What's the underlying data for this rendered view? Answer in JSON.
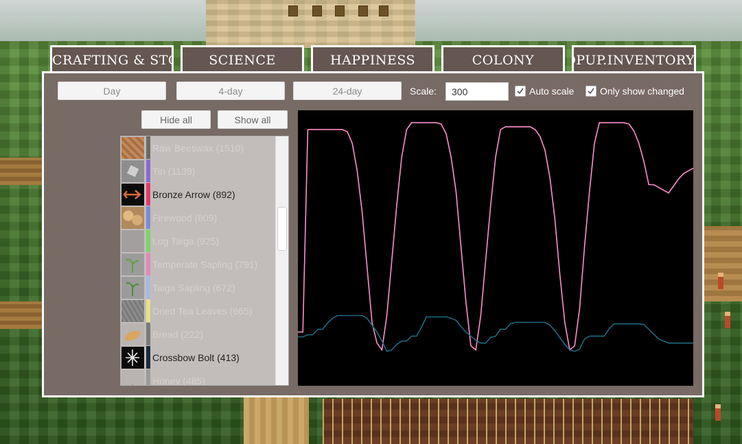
{
  "tabs": [
    {
      "label": "CRAFTING & STOCKPILE"
    },
    {
      "label": "SCIENCE"
    },
    {
      "label": "HAPPINESS"
    },
    {
      "label": "COLONY"
    },
    {
      "label": "POPUP.INVENTORY.STATS.HEADER"
    }
  ],
  "controls": {
    "day": "Day",
    "four_day": "4-day",
    "twentyfour_day": "24-day",
    "scale_label": "Scale:",
    "scale_value": "300",
    "auto_scale_label": "Auto scale",
    "auto_scale_checked": true,
    "only_changed_label": "Only show changed",
    "only_changed_checked": true,
    "hide_all": "Hide all",
    "show_all": "Show all"
  },
  "items": [
    {
      "label": "Raw Beeswax (1510)",
      "color": "#6b6b6b",
      "icon": "beeswax-icon",
      "enabled": false
    },
    {
      "label": "Tin (1139)",
      "color": "#8a6ad1",
      "icon": "tin-icon",
      "enabled": false
    },
    {
      "label": "Bronze Arrow (892)",
      "color": "#e43b6b",
      "icon": "bronze-arrow-icon",
      "enabled": true
    },
    {
      "label": "Firewood (809)",
      "color": "#7d8bd8",
      "icon": "firewood-icon",
      "enabled": false
    },
    {
      "label": "Log Taiga (925)",
      "color": "#7ed36b",
      "icon": "log-taiga-icon",
      "enabled": false
    },
    {
      "label": "Temperate Sapling (791)",
      "color": "#e08ab8",
      "icon": "temperate-sapling-icon",
      "enabled": false
    },
    {
      "label": "Taiga Sapling (672)",
      "color": "#a8b8e0",
      "icon": "taiga-sapling-icon",
      "enabled": false
    },
    {
      "label": "Dried Tea Leaves (665)",
      "color": "#e6e08a",
      "icon": "dried-tea-leaves-icon",
      "enabled": false
    },
    {
      "label": "Bread (222)",
      "color": "#7a7a7a",
      "icon": "bread-icon",
      "enabled": false
    },
    {
      "label": "Crossbow Bolt (413)",
      "color": "#1a2a3a",
      "icon": "crossbow-bolt-icon",
      "enabled": true
    },
    {
      "label": "Honey (485)",
      "color": "#9a9a9a",
      "icon": "honey-icon",
      "enabled": false
    }
  ],
  "chart_data": {
    "type": "line",
    "xlabel": "",
    "ylabel": "",
    "grid": false,
    "x": [
      0,
      1,
      2,
      3,
      4,
      5,
      6,
      7,
      8,
      9,
      10,
      11,
      12,
      13,
      14,
      15,
      16,
      17,
      18,
      19,
      20,
      21,
      22,
      23,
      24,
      25,
      26,
      27,
      28,
      29,
      30,
      31,
      32,
      33,
      34,
      35,
      36,
      37,
      38,
      39,
      40,
      41,
      42,
      43,
      44,
      45,
      46,
      47,
      48,
      49,
      50,
      51,
      52,
      53,
      54,
      55,
      56,
      57,
      58,
      59,
      60,
      61,
      62,
      63,
      64,
      65,
      66,
      67,
      68,
      69,
      70,
      71,
      72,
      73,
      74,
      75,
      76,
      77,
      78,
      79,
      80
    ],
    "series": [
      {
        "name": "Bronze Arrow",
        "color": "#ff8fc8",
        "values": [
          578,
          578,
          872,
          872,
          872,
          872,
          872,
          872,
          872,
          872,
          869,
          852,
          812,
          752,
          672,
          592,
          562,
          552,
          602,
          682,
          762,
          832,
          872,
          882,
          882,
          882,
          882,
          882,
          882,
          880,
          866,
          832,
          782,
          702,
          622,
          558,
          552,
          602,
          682,
          762,
          832,
          872,
          876,
          876,
          876,
          876,
          876,
          876,
          872,
          862,
          842,
          802,
          742,
          662,
          592,
          552,
          558,
          612,
          702,
          782,
          852,
          882,
          882,
          882,
          882,
          882,
          882,
          880,
          870,
          852,
          826,
          792,
          792,
          788,
          784,
          780,
          790,
          800,
          808,
          812,
          816
        ]
      },
      {
        "name": "Crossbow Bolt",
        "color": "#1e6b80",
        "values": [
          571,
          571,
          574,
          574,
          582,
          582,
          591,
          598,
          602,
          602,
          602,
          602,
          602,
          602,
          598,
          588,
          578,
          565,
          550,
          552,
          560,
          565,
          565,
          572,
          572,
          585,
          600,
          600,
          600,
          600,
          600,
          598,
          595,
          586,
          578,
          572,
          566,
          562,
          562,
          570,
          572,
          582,
          582,
          590,
          592,
          592,
          592,
          592,
          592,
          592,
          592,
          588,
          580,
          570,
          560,
          552,
          550,
          553,
          568,
          572,
          572,
          572,
          572,
          583,
          590,
          590,
          590,
          590,
          590,
          590,
          589,
          582,
          575,
          568,
          565,
          562,
          562,
          562,
          562,
          562,
          562
        ]
      }
    ],
    "ylim": [
      500,
      900
    ]
  }
}
